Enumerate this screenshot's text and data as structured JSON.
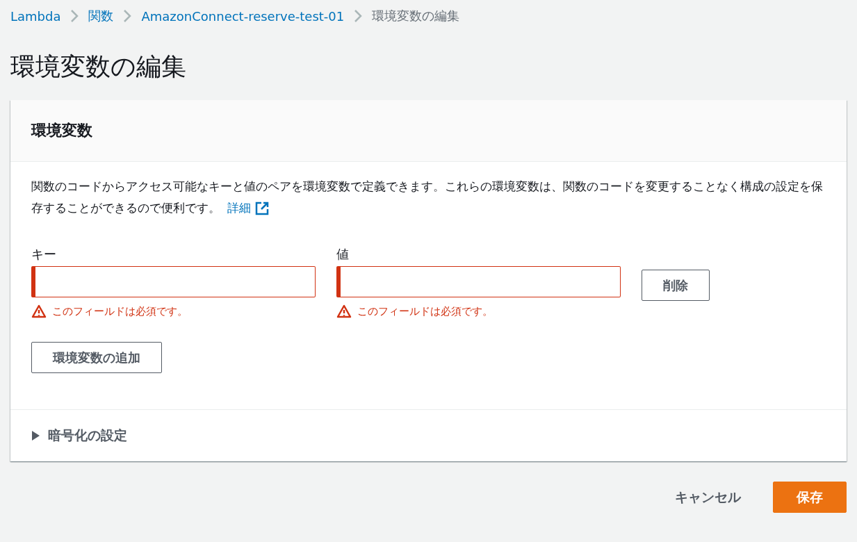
{
  "breadcrumb": [
    {
      "label": "Lambda",
      "current": false
    },
    {
      "label": "関数",
      "current": false
    },
    {
      "label": "AmazonConnect-reserve-test-01",
      "current": false
    },
    {
      "label": "環境変数の編集",
      "current": true
    }
  ],
  "page_title": "環境変数の編集",
  "panel": {
    "title": "環境変数",
    "description": "関数のコードからアクセス可能なキーと値のペアを環境変数で定義できます。これらの環境変数は、関数のコードを変更することなく構成の設定を保存することができるので便利です。",
    "learn_more": "詳細",
    "fields": [
      {
        "label": "キー",
        "invalid": true,
        "error": "このフィールドは必須です。"
      },
      {
        "label": "値",
        "invalid": true,
        "error": "このフィールドは必須です。"
      }
    ],
    "remove_button": "削除",
    "add_button": "環境変数の追加",
    "encryption": {
      "label": "暗号化の設定",
      "expanded": false
    }
  },
  "actions": {
    "cancel": "キャンセル",
    "save": "保存"
  }
}
